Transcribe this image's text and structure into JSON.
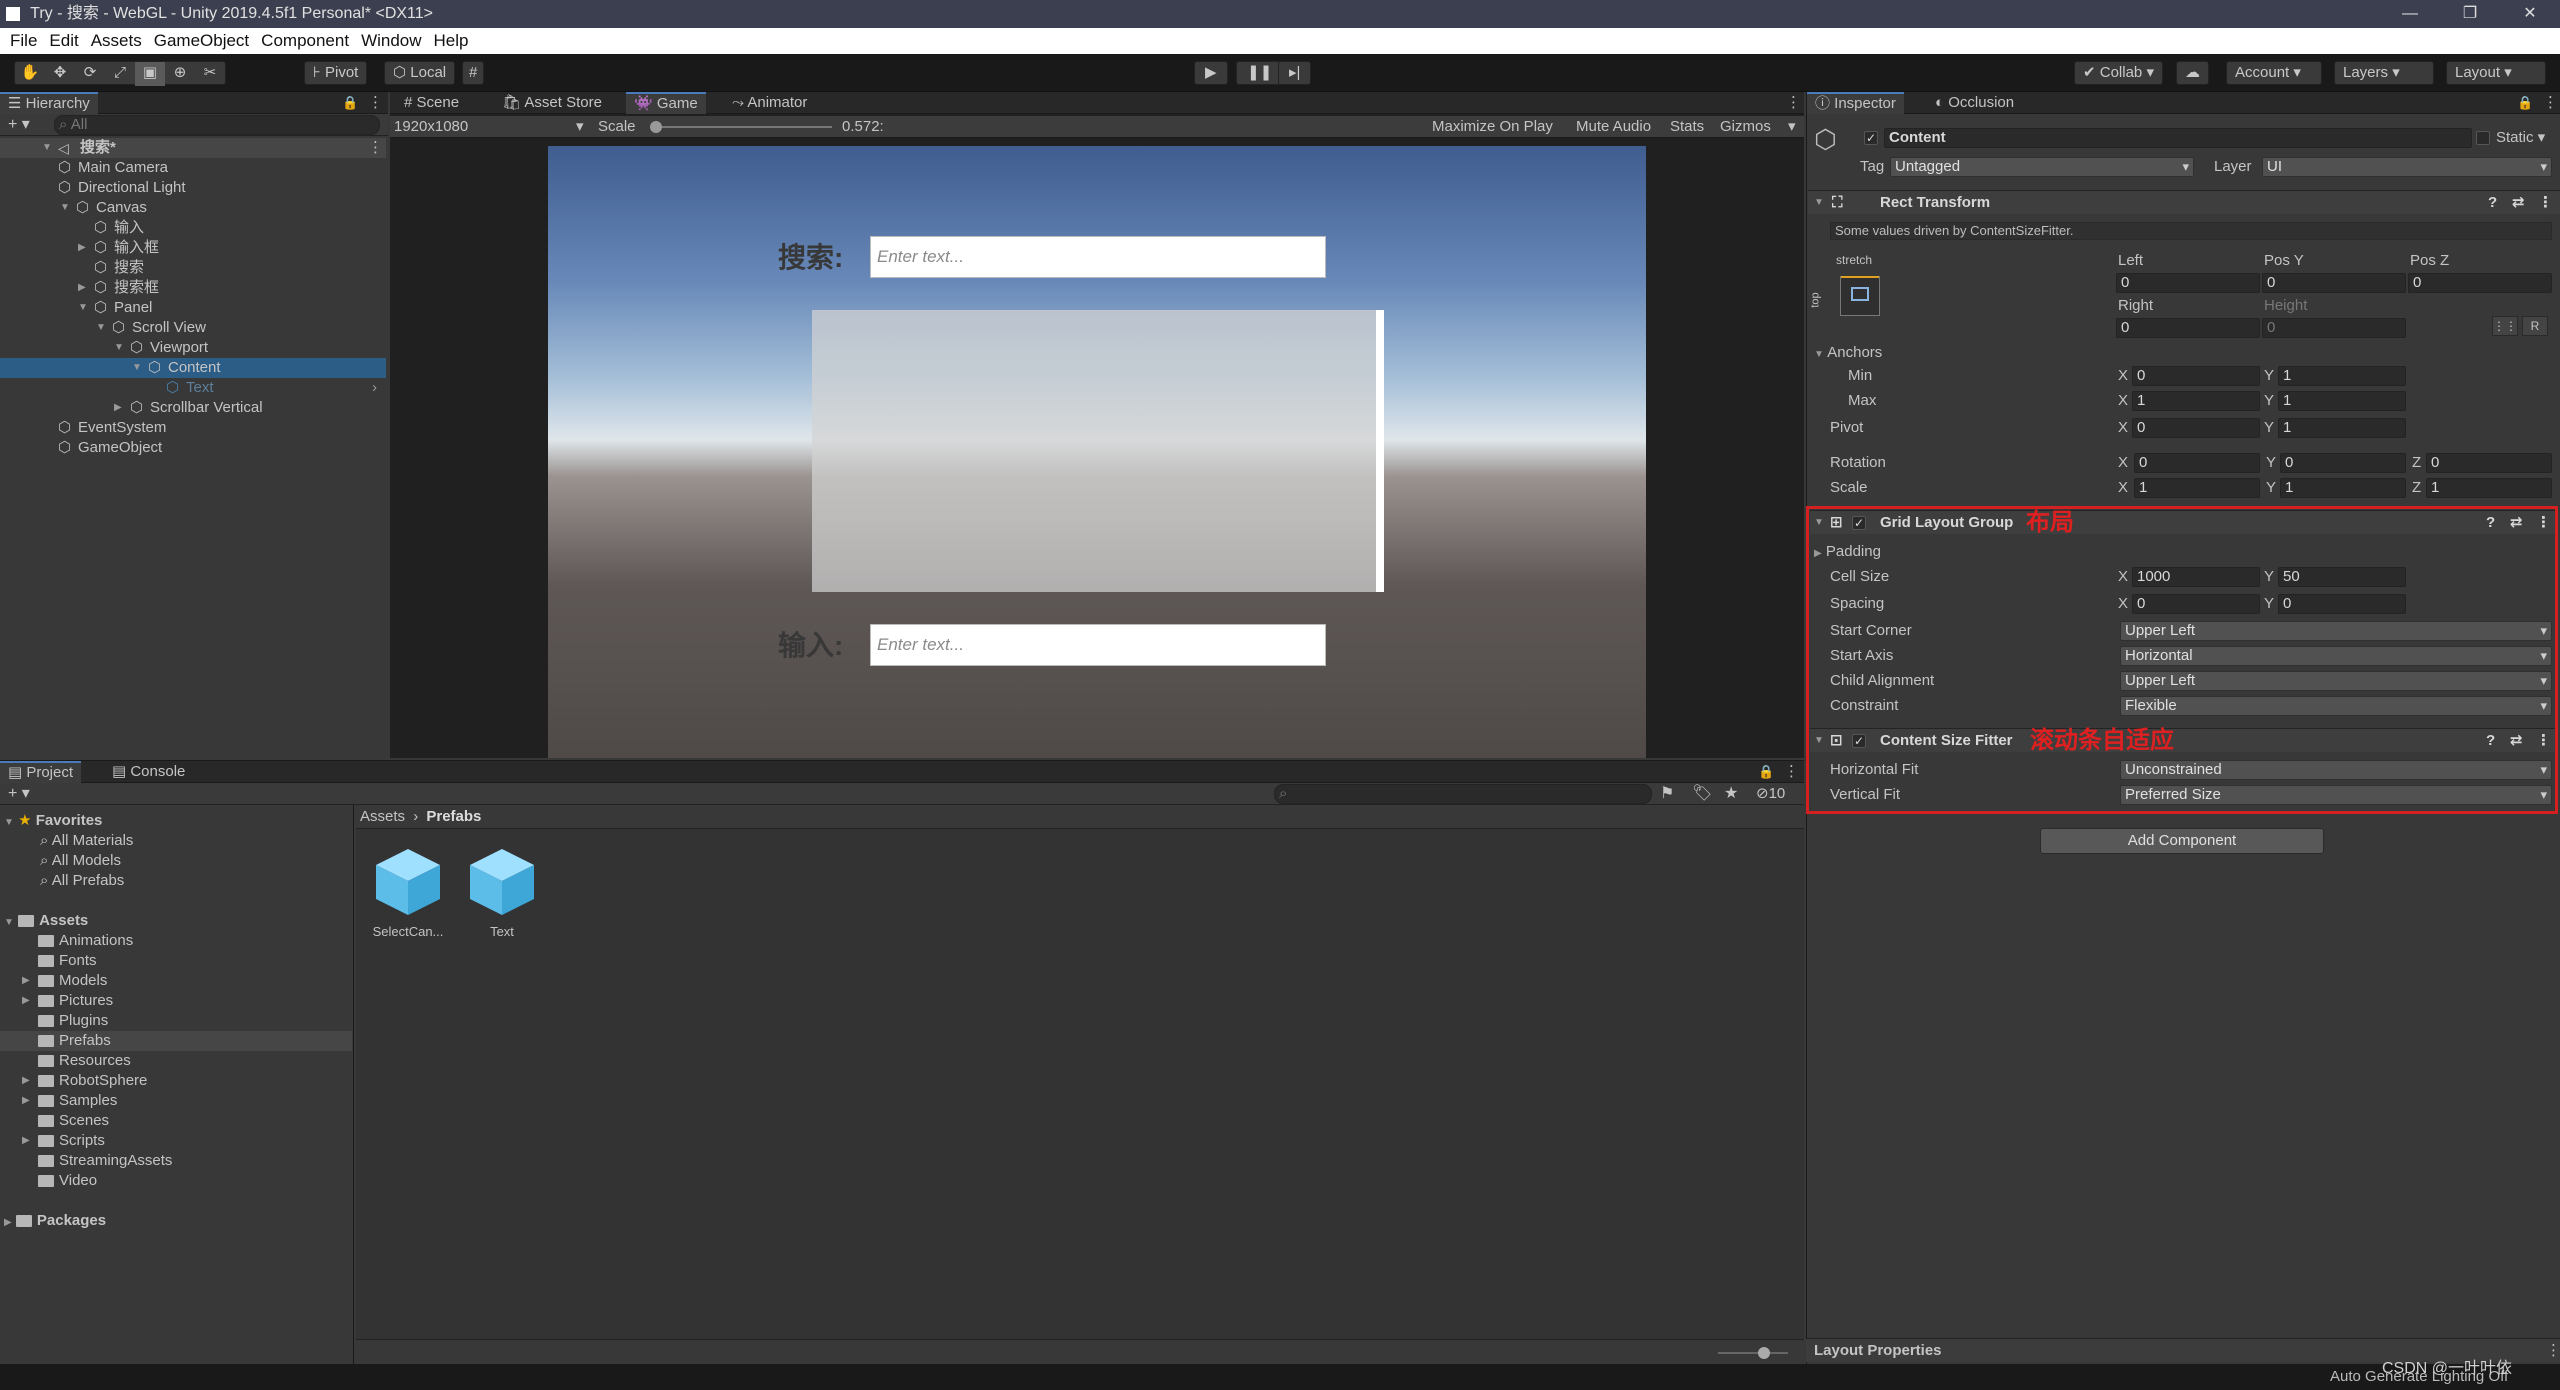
{
  "window": {
    "title": "Try - 搜索 - WebGL - Unity 2019.4.5f1 Personal* <DX11>"
  },
  "menu": [
    "File",
    "Edit",
    "Assets",
    "GameObject",
    "Component",
    "Window",
    "Help"
  ],
  "toolbar": {
    "pivot": "Pivot",
    "local": "Local",
    "collab": "Collab",
    "account": "Account",
    "layers": "Layers",
    "layout": "Layout"
  },
  "hierarchy": {
    "tab": "Hierarchy",
    "search_placeholder": "All",
    "scene": "搜索*",
    "items": [
      "Main Camera",
      "Directional Light",
      "Canvas",
      "输入",
      "输入框",
      "搜索",
      "搜索框",
      "Panel",
      "Scroll View",
      "Viewport",
      "Content",
      "Text",
      "Scrollbar Vertical",
      "EventSystem",
      "GameObject"
    ]
  },
  "center_tabs": [
    "Scene",
    "Asset Store",
    "Game",
    "Animator"
  ],
  "game_bar": {
    "resolution": "1920x1080",
    "scale_label": "Scale",
    "scale_value": "0.572:",
    "maximize": "Maximize On Play",
    "mute": "Mute Audio",
    "stats": "Stats",
    "gizmos": "Gizmos"
  },
  "game_view": {
    "search_label": "搜索:",
    "search_placeholder": "Enter text...",
    "input_label": "输入:",
    "input_placeholder": "Enter text..."
  },
  "project": {
    "tabs": [
      "Project",
      "Console"
    ],
    "hidden_count": "10",
    "favorites_label": "Favorites",
    "favorites": [
      "All Materials",
      "All Models",
      "All Prefabs"
    ],
    "assets_label": "Assets",
    "folders": [
      "Animations",
      "Fonts",
      "Models",
      "Pictures",
      "Plugins",
      "Prefabs",
      "Resources",
      "RobotSphere",
      "Samples",
      "Scenes",
      "Scripts",
      "StreamingAssets",
      "Video"
    ],
    "packages_label": "Packages",
    "breadcrumb": [
      "Assets",
      "Prefabs"
    ],
    "prefabs": [
      "SelectCan...",
      "Text"
    ]
  },
  "inspector": {
    "tabs": [
      "Inspector",
      "Occlusion"
    ],
    "object_name": "Content",
    "static_label": "Static",
    "tag_label": "Tag",
    "tag_value": "Untagged",
    "layer_label": "Layer",
    "layer_value": "UI",
    "rect_transform": {
      "title": "Rect Transform",
      "note": "Some values driven by ContentSizeFitter.",
      "stretch": "stretch",
      "top": "top",
      "left_label": "Left",
      "left": "0",
      "posy_label": "Pos Y",
      "posy": "0",
      "posz_label": "Pos Z",
      "posz": "0",
      "right_label": "Right",
      "right": "0",
      "height_label": "Height",
      "height": "0",
      "anchors": "Anchors",
      "min_label": "Min",
      "min_x": "0",
      "min_y": "1",
      "max_label": "Max",
      "max_x": "1",
      "max_y": "1",
      "pivot_label": "Pivot",
      "pivot_x": "0",
      "pivot_y": "1",
      "rotation_label": "Rotation",
      "rot_x": "0",
      "rot_y": "0",
      "rot_z": "0",
      "scale_label": "Scale",
      "scale_x": "1",
      "scale_y": "1",
      "scale_z": "1"
    },
    "grid_layout": {
      "title": "Grid Layout Group",
      "annotation": "布局",
      "padding": "Padding",
      "cell_size_label": "Cell Size",
      "cell_x": "1000",
      "cell_y": "50",
      "spacing_label": "Spacing",
      "spacing_x": "0",
      "spacing_y": "0",
      "start_corner_label": "Start Corner",
      "start_corner": "Upper Left",
      "start_axis_label": "Start Axis",
      "start_axis": "Horizontal",
      "child_alignment_label": "Child Alignment",
      "child_alignment": "Upper Left",
      "constraint_label": "Constraint",
      "constraint": "Flexible"
    },
    "content_size_fitter": {
      "title": "Content Size Fitter",
      "annotation": "滚动条自适应",
      "hfit_label": "Horizontal Fit",
      "hfit": "Unconstrained",
      "vfit_label": "Vertical Fit",
      "vfit": "Preferred Size"
    },
    "add_component": "Add Component",
    "layout_properties": "Layout Properties"
  },
  "status": {
    "right": "Auto Generate Lighting Off",
    "watermark": "CSDN @一叶叶依"
  },
  "colors": {
    "highlight": "#e02020",
    "selection": "#2c5d87"
  }
}
